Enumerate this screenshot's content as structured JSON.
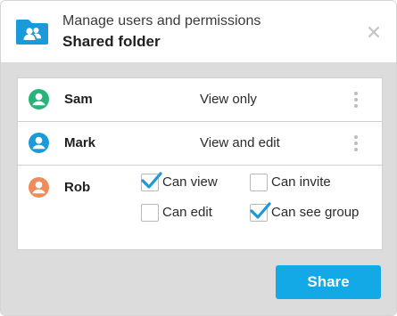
{
  "dialog": {
    "subtitle": "Manage users and permissions",
    "title": "Shared folder",
    "close_icon": "close-icon",
    "folder_icon": "shared-folder-icon"
  },
  "users": [
    {
      "name": "Sam",
      "permission": "View only",
      "avatar_color": "#2ab27b"
    },
    {
      "name": "Mark",
      "permission": "View and edit",
      "avatar_color": "#1a9ad8"
    },
    {
      "name": "Rob",
      "avatar_color": "#f08c5a",
      "options": [
        {
          "label": "Can view",
          "checked": true
        },
        {
          "label": "Can invite",
          "checked": false
        },
        {
          "label": "Can edit",
          "checked": false
        },
        {
          "label": "Can see group",
          "checked": true
        }
      ]
    }
  ],
  "actions": {
    "share_label": "Share"
  },
  "colors": {
    "accent": "#12a9e6",
    "check": "#1a9ad8"
  }
}
